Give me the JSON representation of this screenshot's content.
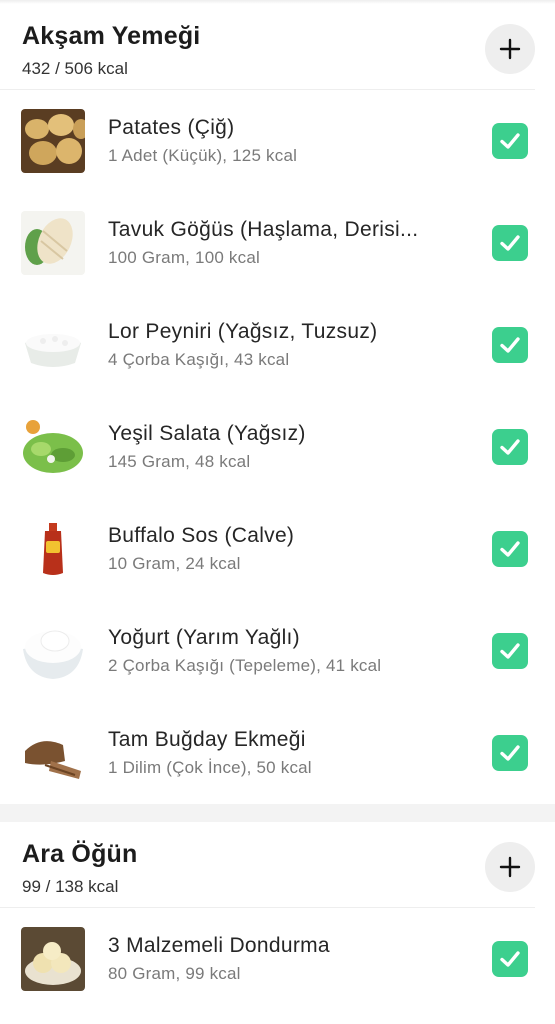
{
  "colors": {
    "check": "#3ccf8e",
    "add_bg": "#eeeeee",
    "band": "#f3f3f3"
  },
  "sections": [
    {
      "title": "Akşam Yemeği",
      "kcal": "432 / 506 kcal",
      "add_icon": "plus-icon",
      "items": [
        {
          "name": "Patates (Çiğ)",
          "detail": "1 Adet (Küçük), 125 kcal",
          "thumb": "potatoes"
        },
        {
          "name": "Tavuk Göğüs (Haşlama, Derisi...",
          "detail": "100 Gram, 100 kcal",
          "thumb": "chicken-breast"
        },
        {
          "name": "Lor Peyniri (Yağsız, Tuzsuz)",
          "detail": "4 Çorba Kaşığı, 43 kcal",
          "thumb": "cottage-cheese"
        },
        {
          "name": "Yeşil Salata (Yağsız)",
          "detail": "145 Gram, 48 kcal",
          "thumb": "green-salad"
        },
        {
          "name": "Buffalo Sos (Calve)",
          "detail": "10 Gram, 24 kcal",
          "thumb": "sauce-bottle"
        },
        {
          "name": "Yoğurt (Yarım Yağlı)",
          "detail": "2 Çorba Kaşığı (Tepeleme), 41 kcal",
          "thumb": "yogurt-bowl"
        },
        {
          "name": "Tam Buğday Ekmeği",
          "detail": "1 Dilim (Çok İnce), 50 kcal",
          "thumb": "wholewheat-bread"
        }
      ]
    },
    {
      "title": "Ara Öğün",
      "kcal": "99 / 138 kcal",
      "add_icon": "plus-icon",
      "items": [
        {
          "name": "3 Malzemeli Dondurma",
          "detail": "80 Gram, 99 kcal",
          "thumb": "ice-cream"
        }
      ]
    }
  ]
}
